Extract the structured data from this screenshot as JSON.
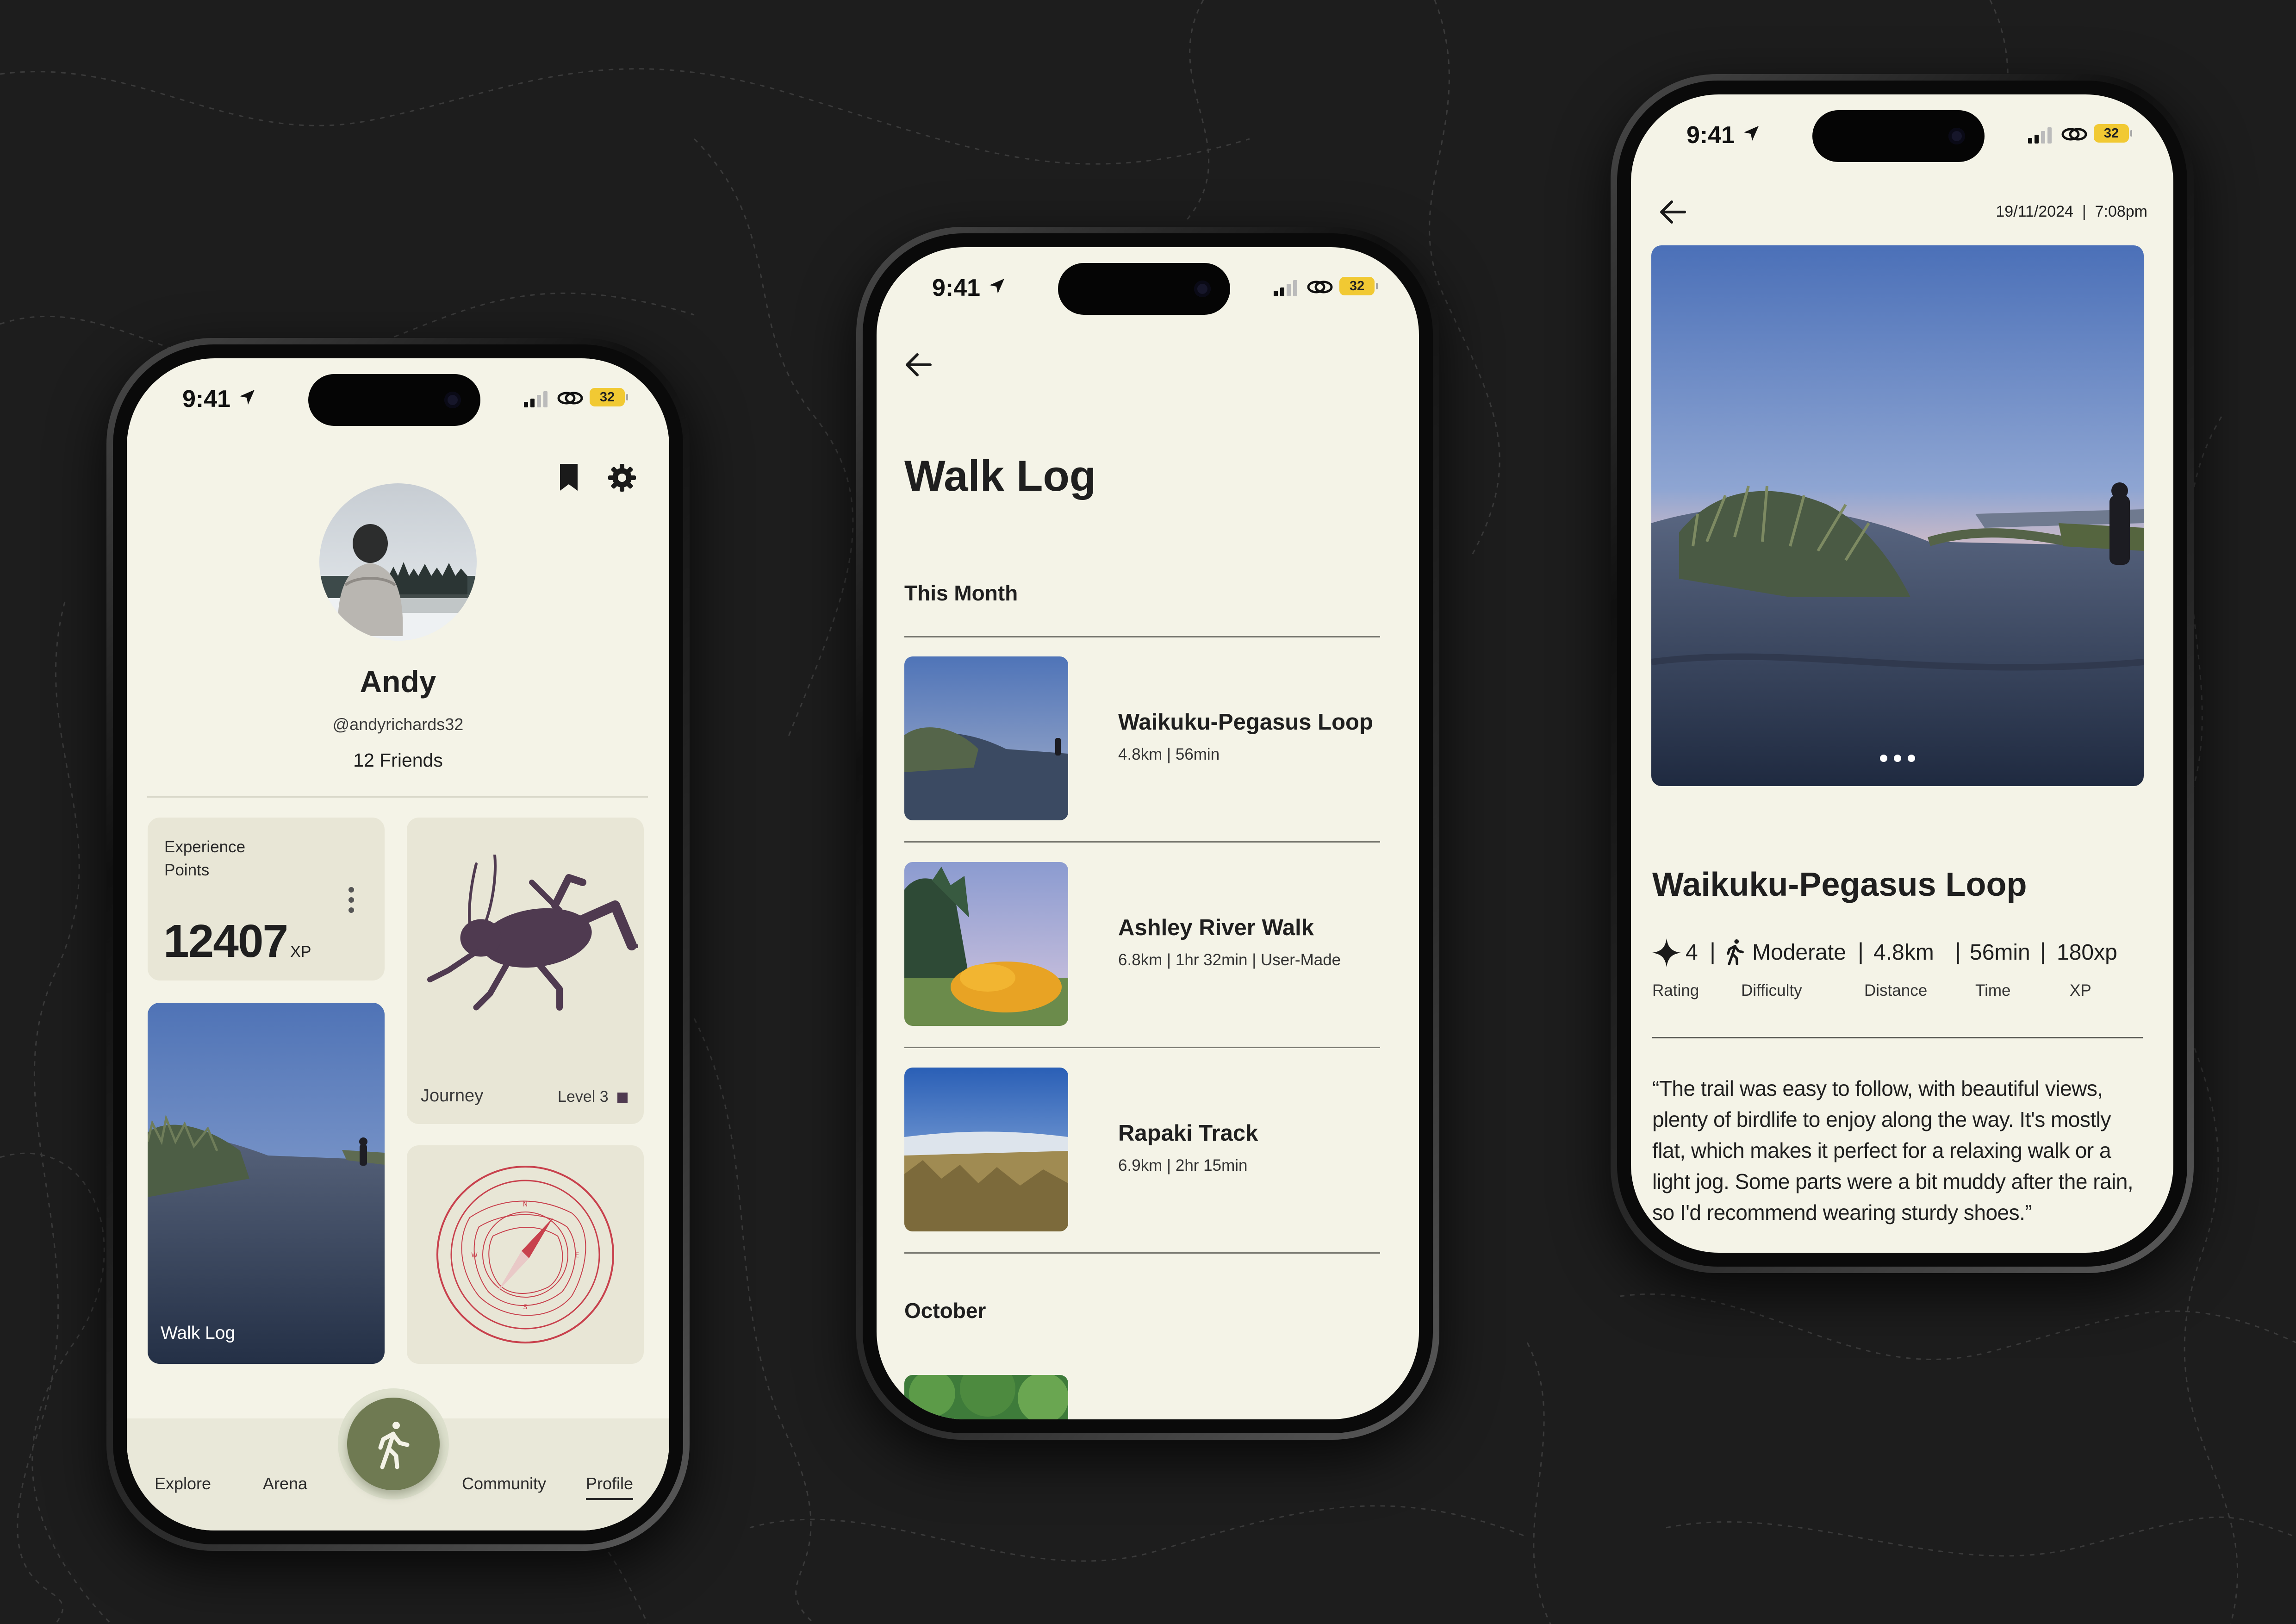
{
  "status": {
    "time": "9:41",
    "battery": "32"
  },
  "profile": {
    "name": "Andy",
    "handle": "@andyrichards32",
    "friends": "12 Friends",
    "xp_label_line1": "Experience",
    "xp_label_line2": "Points",
    "xp_value": "12407",
    "xp_unit": "XP",
    "journey_label": "Journey",
    "journey_level": "Level 3",
    "walklog_label": "Walk Log",
    "nav": {
      "explore": "Explore",
      "arena": "Arena",
      "community": "Community",
      "profile": "Profile"
    }
  },
  "walklog": {
    "title": "Walk Log",
    "section1": "This Month",
    "section2": "October",
    "items": [
      {
        "name": "Waikuku-Pegasus Loop",
        "meta": "4.8km | 56min"
      },
      {
        "name": "Ashley River Walk",
        "meta": "6.8km | 1hr 32min | User-Made"
      },
      {
        "name": "Rapaki Track",
        "meta": "6.9km | 2hr 15min"
      }
    ]
  },
  "detail": {
    "datetime": "19/11/2024  |  7:08pm",
    "title": "Waikuku-Pegasus Loop",
    "stats": [
      {
        "value": "4",
        "label": "Rating"
      },
      {
        "value": "Moderate",
        "label": "Difficulty"
      },
      {
        "value": "4.8km",
        "label": "Distance"
      },
      {
        "value": "56min",
        "label": "Time"
      },
      {
        "value": "180xp",
        "label": "XP"
      }
    ],
    "review": "“The trail was easy to follow, with beautiful views, plenty of birdlife to enjoy along the way. It's mostly flat, which makes it perfect for a relaxing walk or a light jog. Some parts were a bit muddy after the rain, so I'd recommend wearing sturdy shoes.”"
  },
  "colors": {
    "screen_bg": "#f4f3e7",
    "card_bg": "#e8e6d6",
    "accent_green": "#6f7a52",
    "cricket": "#4f3a50",
    "compass_red": "#c8414d",
    "battery": "#f1c933"
  }
}
